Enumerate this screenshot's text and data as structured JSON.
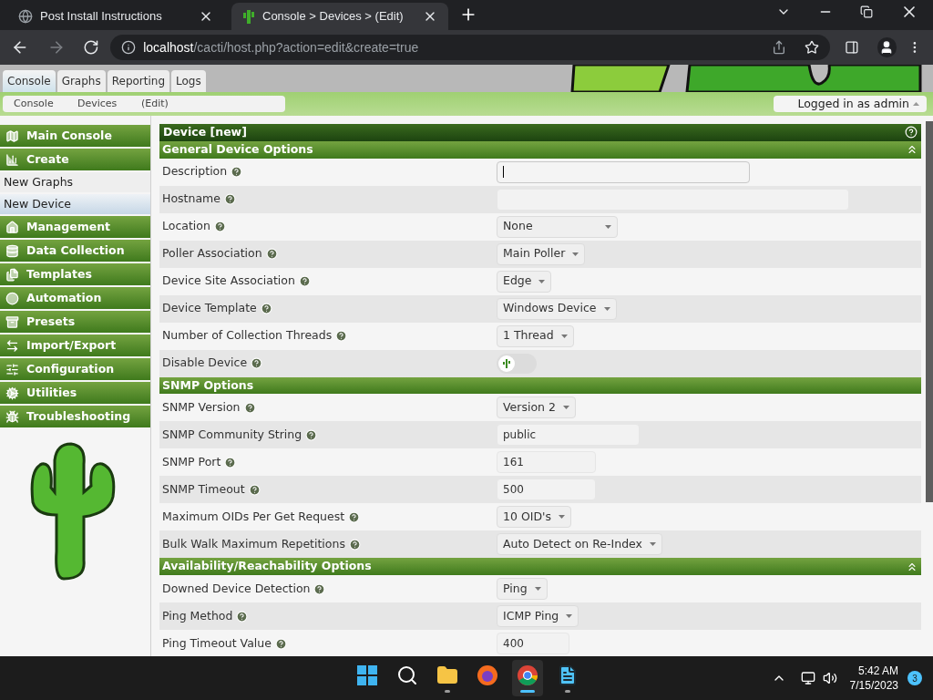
{
  "browser": {
    "tabs": [
      {
        "title": "Post Install Instructions",
        "selected": false
      },
      {
        "title": "Console > Devices > (Edit)",
        "selected": true
      }
    ],
    "url_host": "localhost",
    "url_path": "/cacti/host.php?action=edit&create=true"
  },
  "top_tabs": [
    {
      "label": "Console",
      "selected": true
    },
    {
      "label": "Graphs",
      "selected": false
    },
    {
      "label": "Reporting",
      "selected": false
    },
    {
      "label": "Logs",
      "selected": false
    }
  ],
  "breadcrumb": [
    "Console",
    "Devices",
    "(Edit)"
  ],
  "user_menu": "Logged in as admin",
  "sidebar": [
    {
      "kind": "header",
      "label": "Main Console"
    },
    {
      "kind": "header",
      "label": "Create"
    },
    {
      "kind": "link",
      "label": "New Graphs",
      "selected": false
    },
    {
      "kind": "link",
      "label": "New Device",
      "selected": true
    },
    {
      "kind": "header",
      "label": "Management"
    },
    {
      "kind": "header",
      "label": "Data Collection"
    },
    {
      "kind": "header",
      "label": "Templates"
    },
    {
      "kind": "header",
      "label": "Automation"
    },
    {
      "kind": "header",
      "label": "Presets"
    },
    {
      "kind": "header",
      "label": "Import/Export"
    },
    {
      "kind": "header",
      "label": "Configuration"
    },
    {
      "kind": "header",
      "label": "Utilities"
    },
    {
      "kind": "header",
      "label": "Troubleshooting"
    }
  ],
  "form": {
    "title": "Device [new]",
    "sections": [
      {
        "title": "General Device Options",
        "collapsible": true,
        "rows": [
          {
            "label": "Description",
            "kind": "text",
            "value": "",
            "focused": true
          },
          {
            "label": "Hostname",
            "kind": "text",
            "value": "",
            "focused": false
          },
          {
            "label": "Location",
            "kind": "select",
            "value": "None"
          },
          {
            "label": "Poller Association",
            "kind": "select",
            "value": "Main Poller"
          },
          {
            "label": "Device Site Association",
            "kind": "select",
            "value": "Edge"
          },
          {
            "label": "Device Template",
            "kind": "select",
            "value": "Windows Device"
          },
          {
            "label": "Number of Collection Threads",
            "kind": "select",
            "value": "1 Thread"
          },
          {
            "label": "Disable Device",
            "kind": "toggle",
            "on": false
          }
        ]
      },
      {
        "title": "SNMP Options",
        "collapsible": false,
        "rows": [
          {
            "label": "SNMP Version",
            "kind": "select",
            "value": "Version 2"
          },
          {
            "label": "SNMP Community String",
            "kind": "text",
            "value": "public",
            "focused": false
          },
          {
            "label": "SNMP Port",
            "kind": "text",
            "value": "161",
            "focused": false
          },
          {
            "label": "SNMP Timeout",
            "kind": "text",
            "value": "500",
            "focused": false
          },
          {
            "label": "Maximum OIDs Per Get Request",
            "kind": "select",
            "value": "10 OID's"
          },
          {
            "label": "Bulk Walk Maximum Repetitions",
            "kind": "select",
            "value": "Auto Detect on Re-Index"
          }
        ]
      },
      {
        "title": "Availability/Reachability Options",
        "collapsible": true,
        "rows": [
          {
            "label": "Downed Device Detection",
            "kind": "select",
            "value": "Ping"
          },
          {
            "label": "Ping Method",
            "kind": "select",
            "value": "ICMP Ping"
          },
          {
            "label": "Ping Timeout Value",
            "kind": "text",
            "value": "400",
            "focused": false
          }
        ]
      }
    ]
  },
  "taskbar": {
    "apps": [
      {
        "running": false
      },
      {
        "running": false
      },
      {
        "running": true
      },
      {
        "running": false
      },
      {
        "running": true
      },
      {
        "running": true
      }
    ],
    "time": "5:42 AM",
    "date": "7/15/2023",
    "notifications": "3"
  }
}
